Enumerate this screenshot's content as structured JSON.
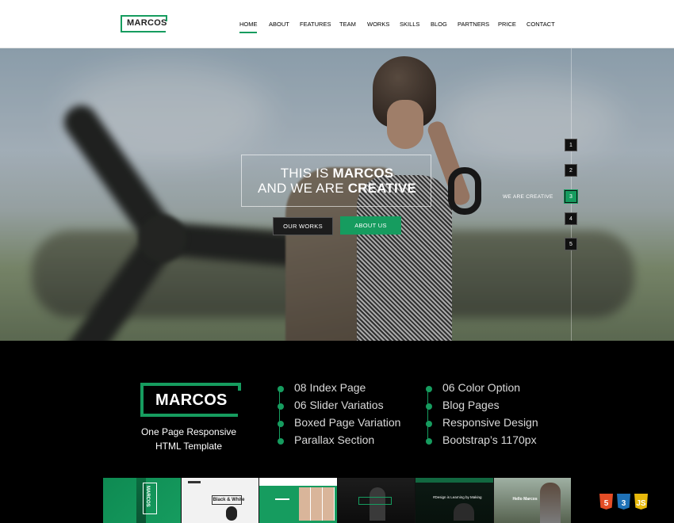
{
  "brand": {
    "logo_text": "MARCOS",
    "accent": "#169c5f"
  },
  "nav": {
    "items": [
      {
        "label": "HOME",
        "active": true
      },
      {
        "label": "ABOUT"
      },
      {
        "label": "FEATURES"
      },
      {
        "label": "TEAM"
      },
      {
        "label": "WORKS"
      },
      {
        "label": "SKILLS"
      },
      {
        "label": "BLOG"
      },
      {
        "label": "PARTNERS"
      },
      {
        "label": "PRICE"
      },
      {
        "label": "CONTACT"
      }
    ]
  },
  "hero": {
    "line1_prefix": "THIS IS",
    "line1_strong": "MARCOS",
    "line2_prefix": "AND WE ARE",
    "line2_strong": "CREATIVE",
    "btn_works": "OUR WORKS",
    "btn_about": "ABOUT US",
    "slider": {
      "dots": [
        "1",
        "2",
        "3",
        "4",
        "5"
      ],
      "active_index": 2,
      "caption": "WE ARE CREATIVE"
    }
  },
  "promo": {
    "brand": "MARCOS",
    "tagline_line1": "One Page Responsive",
    "tagline_line2": "HTML Template",
    "features_left": [
      "08 Index Page",
      "06 Slider Variatios",
      "Boxed Page Variation",
      "Parallax Section"
    ],
    "features_right": [
      "06 Color Option",
      "Blog Pages",
      "Responsive Design",
      "Bootstrap’s 1170px"
    ],
    "thumb_labels": [
      "MARCOS",
      "Black & White",
      "",
      "",
      "#Design is Learning by Making",
      "Hello Marcos"
    ],
    "tech_icons": [
      {
        "name": "html5-icon",
        "glyph": "5",
        "color": "#e44d26"
      },
      {
        "name": "css3-icon",
        "glyph": "3",
        "color": "#1f72b8"
      },
      {
        "name": "js-icon",
        "glyph": "JS",
        "color": "#e8b90b"
      }
    ]
  }
}
